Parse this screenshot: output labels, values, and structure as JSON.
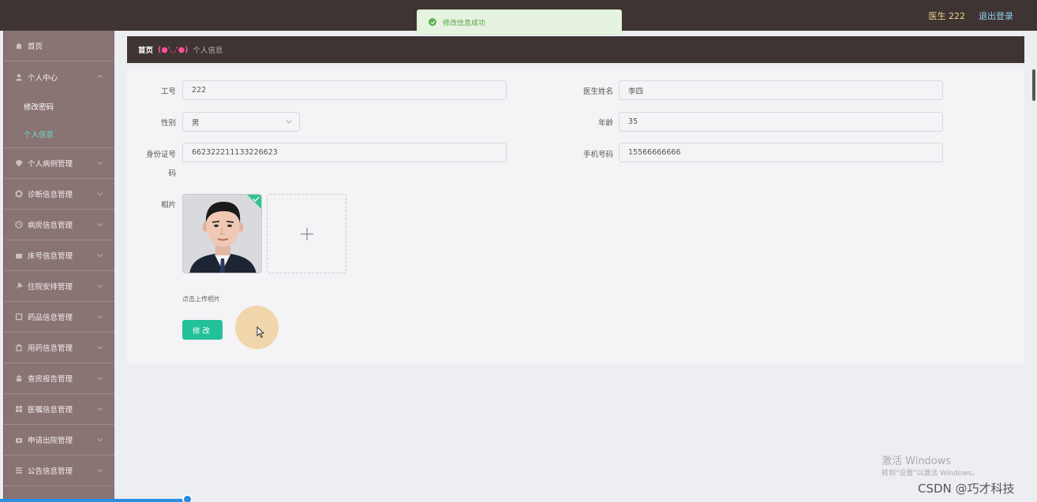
{
  "header": {
    "user_label": "医生 222",
    "logout_label": "退出登录"
  },
  "toast": {
    "message": "修改信息成功",
    "icon": "check-circle-icon",
    "color": "#5fb554"
  },
  "sidebar": {
    "items": [
      {
        "label": "首页",
        "icon": "home-icon"
      },
      {
        "label": "个人中心",
        "icon": "user-icon",
        "expanded": true,
        "children": [
          {
            "label": "修改密码"
          },
          {
            "label": "个人信息",
            "active": true
          }
        ]
      },
      {
        "label": "个人病例管理",
        "icon": "shield-icon"
      },
      {
        "label": "诊断信息管理",
        "icon": "gear-icon"
      },
      {
        "label": "病房信息管理",
        "icon": "clock-icon"
      },
      {
        "label": "床号信息管理",
        "icon": "bed-icon"
      },
      {
        "label": "住院安排管理",
        "icon": "pin-icon"
      },
      {
        "label": "药品信息管理",
        "icon": "box-icon"
      },
      {
        "label": "用药信息管理",
        "icon": "bag-icon"
      },
      {
        "label": "查房报告管理",
        "icon": "bank-icon"
      },
      {
        "label": "医嘱信息管理",
        "icon": "grid-icon"
      },
      {
        "label": "申请出院管理",
        "icon": "camera-icon"
      },
      {
        "label": "公告信息管理",
        "icon": "list-icon"
      }
    ]
  },
  "breadcrumb": {
    "home": "首页",
    "separator": "(●'◡'●)",
    "current": "个人信息"
  },
  "form": {
    "employee_id_label": "工号",
    "employee_id": "222",
    "doctor_name_label": "医生姓名",
    "doctor_name": "李四",
    "gender_label": "性别",
    "gender": "男",
    "age_label": "年龄",
    "age": "35",
    "id_number_label_1": "身份证号",
    "id_number_label_2": "码",
    "id_number": "662322211133226623",
    "phone_label": "手机号码",
    "phone": "15566666666",
    "photo_label": "相片",
    "upload_tip": "点击上传相片",
    "submit_label": "修改"
  },
  "watermark": {
    "activate_title": "激活 Windows",
    "activate_sub": "转到\"设置\"以激活 Windows。",
    "csdn": "CSDN @巧才科技"
  },
  "video_progress": 0.18,
  "colors": {
    "accent": "#23c19a",
    "sidebar_bg": "#8a7373",
    "header_bg": "#3e3434",
    "active_sub": "#66e0c8"
  }
}
